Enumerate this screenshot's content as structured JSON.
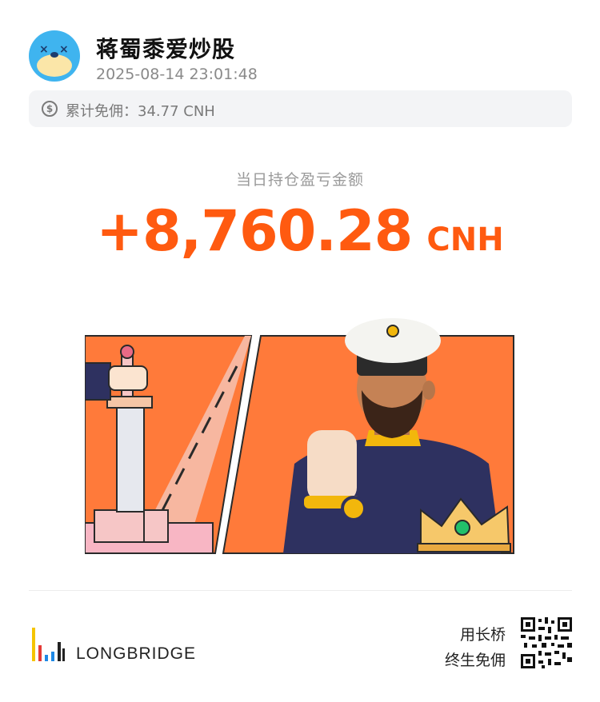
{
  "header": {
    "username": "蒋蜀黍爱炒股",
    "datetime": "2025-08-14 23:01:48"
  },
  "fee": {
    "icon": "dollar-circle-icon",
    "text": "累计免佣：34.77 CNH"
  },
  "pnl": {
    "label": "当日持仓盈亏金额",
    "value": "+8,760.28",
    "currency": "CNH"
  },
  "footer": {
    "brand": "LONGBRIDGE",
    "slogan_line1": "用长桥",
    "slogan_line2": "终生免佣"
  },
  "colors": {
    "accent": "#ff5a10",
    "illustration_bg": "#ff7a3a",
    "navy": "#2e3160"
  }
}
